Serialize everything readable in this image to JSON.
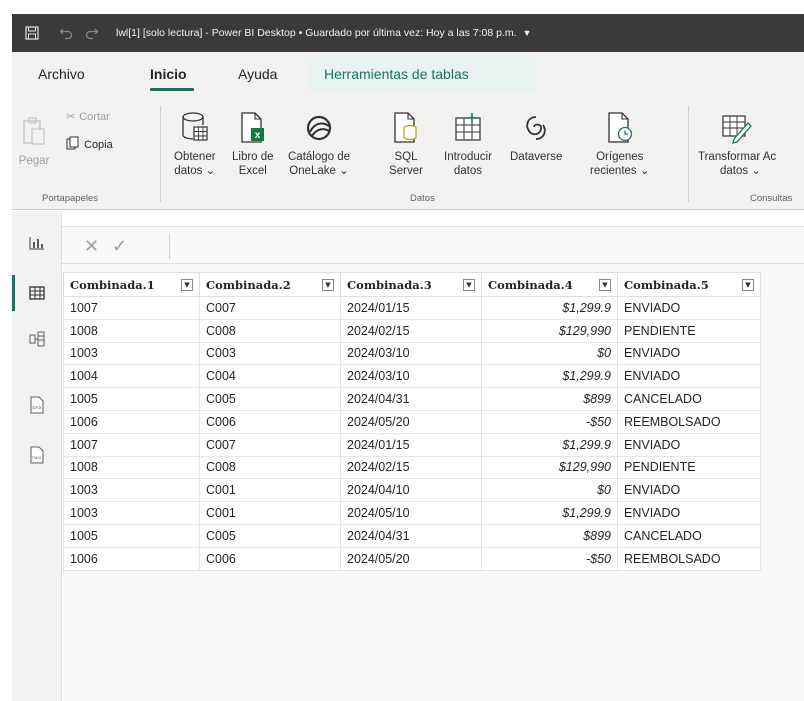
{
  "window": {
    "title": "lwl[1] [solo lectura] - Power BI Desktop • Guardado por última vez: Hoy a las 7:08 p.m."
  },
  "tabs": [
    {
      "label": "Archivo"
    },
    {
      "label": "Inicio"
    },
    {
      "label": "Ayuda"
    },
    {
      "label": "Herramientas de tablas"
    }
  ],
  "ribbon": {
    "paste": "Pegar",
    "cut": "Cortar",
    "copy": "Copia",
    "group_clipboard": "Portapapeles",
    "get_data": [
      "Obtener",
      "datos ⌄"
    ],
    "excel": [
      "Libro de",
      "Excel"
    ],
    "onelake": [
      "Catálogo de",
      "OneLake ⌄"
    ],
    "sql": [
      "SQL",
      "Server"
    ],
    "enter_data": [
      "Introducir",
      "datos"
    ],
    "dataverse": [
      "Dataverse"
    ],
    "recent": [
      "Orígenes",
      "recientes ⌄"
    ],
    "group_data": "Datos",
    "transform": [
      "Transformar",
      "datos ⌄"
    ],
    "transform_extra": "Ac",
    "group_queries": "Consultas"
  },
  "formula": {
    "cancel": "✕",
    "confirm": "✓"
  },
  "table": {
    "columns": [
      "Combinada.1",
      "Combinada.2",
      "Combinada.3",
      "Combinada.4",
      "Combinada.5"
    ],
    "rows": [
      [
        "1007",
        "C007",
        "2024/01/15",
        "$1,299.9",
        "ENVIADO"
      ],
      [
        "1008",
        "C008",
        "2024/02/15",
        "$129,990",
        "PENDIENTE"
      ],
      [
        "1003",
        "C003",
        "2024/03/10",
        "$0",
        "ENVIADO"
      ],
      [
        "1004",
        "C004",
        "2024/03/10",
        "$1,299.9",
        "ENVIADO"
      ],
      [
        "1005",
        "C005",
        "2024/04/31",
        "$899",
        "CANCELADO"
      ],
      [
        "1006",
        "C006",
        "2024/05/20",
        "-$50",
        "REEMBOLSADO"
      ],
      [
        "1007",
        "C007",
        "2024/01/15",
        "$1,299.9",
        "ENVIADO"
      ],
      [
        "1008",
        "C008",
        "2024/02/15",
        "$129,990",
        "PENDIENTE"
      ],
      [
        "1003",
        "C001",
        "2024/04/10",
        "$0",
        "ENVIADO"
      ],
      [
        "1003",
        "C001",
        "2024/05/10",
        "$1,299.9",
        "ENVIADO"
      ],
      [
        "1005",
        "C005",
        "2024/04/31",
        "$899",
        "CANCELADO"
      ],
      [
        "1006",
        "C006",
        "2024/05/20",
        "-$50",
        "REEMBOLSADO"
      ]
    ]
  },
  "rail": [
    "report-view-icon",
    "table-view-icon",
    "model-view-icon",
    "dax-query-icon",
    "tmdl-view-icon"
  ],
  "colors": {
    "accent": "#117865",
    "titlebar": "#3b3a39"
  }
}
